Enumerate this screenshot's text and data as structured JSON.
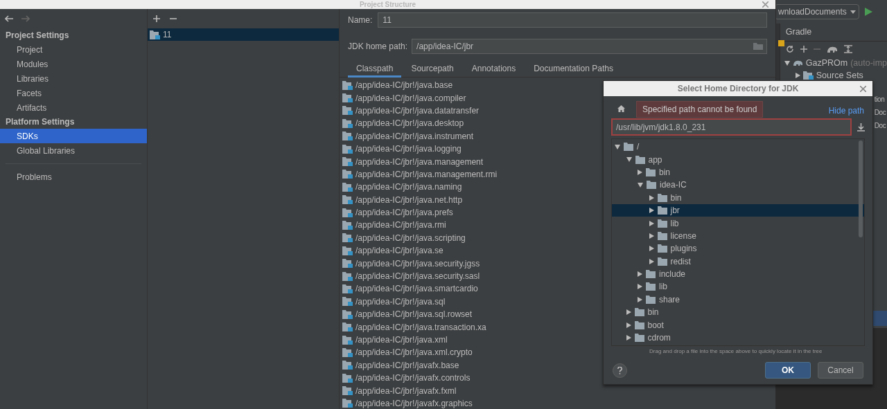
{
  "ide_background": {
    "run_config": "wnloadDocuments",
    "gradle": {
      "title": "Gradle",
      "tree": [
        {
          "label": "GazPROm",
          "note": "(auto-imp",
          "expanded": true,
          "children": [
            {
              "label": "Source Sets",
              "expanded": false
            }
          ]
        }
      ]
    },
    "fragments": [
      "tion",
      "Doc",
      "Doc"
    ]
  },
  "project_structure": {
    "title": "Project Structure",
    "sidebar": [
      {
        "heading": "Project Settings",
        "items": [
          {
            "label": "Project",
            "selected": false
          },
          {
            "label": "Modules",
            "selected": false
          },
          {
            "label": "Libraries",
            "selected": false
          },
          {
            "label": "Facets",
            "selected": false
          },
          {
            "label": "Artifacts",
            "selected": false
          }
        ]
      },
      {
        "heading": "Platform Settings",
        "items": [
          {
            "label": "SDKs",
            "selected": true
          },
          {
            "label": "Global Libraries",
            "selected": false
          }
        ]
      },
      {
        "items": [
          {
            "label": "Problems",
            "selected": false
          }
        ]
      }
    ],
    "sdks": [
      {
        "label": "11",
        "selected": true
      }
    ],
    "name_label": "Name:",
    "name_value": "11",
    "home_label": "JDK home path:",
    "home_value": "/app/idea-IC/jbr",
    "tabs": [
      {
        "label": "Classpath",
        "selected": true
      },
      {
        "label": "Sourcepath",
        "selected": false
      },
      {
        "label": "Annotations",
        "selected": false
      },
      {
        "label": "Documentation Paths",
        "selected": false
      }
    ],
    "classpath": [
      "/app/idea-IC/jbr!/java.base",
      "/app/idea-IC/jbr!/java.compiler",
      "/app/idea-IC/jbr!/java.datatransfer",
      "/app/idea-IC/jbr!/java.desktop",
      "/app/idea-IC/jbr!/java.instrument",
      "/app/idea-IC/jbr!/java.logging",
      "/app/idea-IC/jbr!/java.management",
      "/app/idea-IC/jbr!/java.management.rmi",
      "/app/idea-IC/jbr!/java.naming",
      "/app/idea-IC/jbr!/java.net.http",
      "/app/idea-IC/jbr!/java.prefs",
      "/app/idea-IC/jbr!/java.rmi",
      "/app/idea-IC/jbr!/java.scripting",
      "/app/idea-IC/jbr!/java.se",
      "/app/idea-IC/jbr!/java.security.jgss",
      "/app/idea-IC/jbr!/java.security.sasl",
      "/app/idea-IC/jbr!/java.smartcardio",
      "/app/idea-IC/jbr!/java.sql",
      "/app/idea-IC/jbr!/java.sql.rowset",
      "/app/idea-IC/jbr!/java.transaction.xa",
      "/app/idea-IC/jbr!/java.xml",
      "/app/idea-IC/jbr!/java.xml.crypto",
      "/app/idea-IC/jbr!/javafx.base",
      "/app/idea-IC/jbr!/javafx.controls",
      "/app/idea-IC/jbr!/javafx.fxml",
      "/app/idea-IC/jbr!/javafx.graphics"
    ]
  },
  "dialog": {
    "title": "Select Home Directory for JDK",
    "error": "Specified path cannot be found",
    "hide_path": "Hide path",
    "path_value": "/usr/lib/jvm/jdk1.8.0_231",
    "tree": [
      {
        "label": "/",
        "expanded": true,
        "selected": false,
        "children": [
          {
            "label": "app",
            "expanded": true,
            "selected": false,
            "children": [
              {
                "label": "bin",
                "expanded": false,
                "selected": false
              },
              {
                "label": "idea-IC",
                "expanded": true,
                "selected": false,
                "children": [
                  {
                    "label": "bin",
                    "expanded": false,
                    "selected": false
                  },
                  {
                    "label": "jbr",
                    "expanded": false,
                    "selected": true
                  },
                  {
                    "label": "lib",
                    "expanded": false,
                    "selected": false
                  },
                  {
                    "label": "license",
                    "expanded": false,
                    "selected": false
                  },
                  {
                    "label": "plugins",
                    "expanded": false,
                    "selected": false
                  },
                  {
                    "label": "redist",
                    "expanded": false,
                    "selected": false
                  }
                ]
              },
              {
                "label": "include",
                "expanded": false,
                "selected": false
              },
              {
                "label": "lib",
                "expanded": false,
                "selected": false
              },
              {
                "label": "share",
                "expanded": false,
                "selected": false
              }
            ]
          },
          {
            "label": "bin",
            "expanded": false,
            "selected": false
          },
          {
            "label": "boot",
            "expanded": false,
            "selected": false
          },
          {
            "label": "cdrom",
            "expanded": false,
            "selected": false
          }
        ]
      }
    ],
    "hint": "Drag and drop a file into the space above to quickly locate it in the tree",
    "buttons": [
      {
        "label": "OK",
        "default": true
      },
      {
        "label": "Cancel",
        "default": false
      }
    ]
  }
}
